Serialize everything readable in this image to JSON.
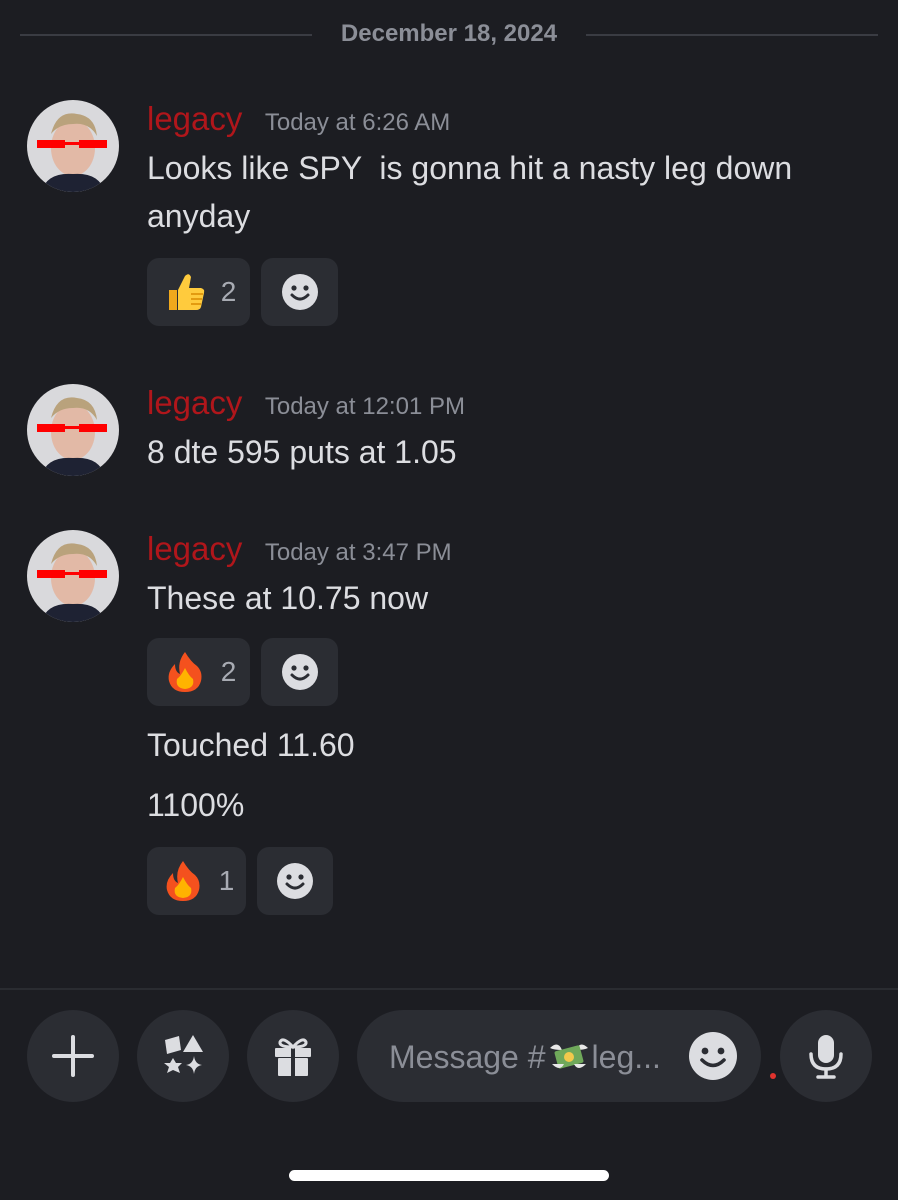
{
  "date_divider": "December 18, 2024",
  "messages": [
    {
      "author": "legacy",
      "timestamp": "Today at 6:26 AM",
      "lines": [
        "Looks like SPY  is gonna hit a nasty leg down",
        "anyday"
      ],
      "reactions": [
        {
          "emoji": "thumbs-up-icon",
          "count": "2"
        }
      ]
    },
    {
      "author": "legacy",
      "timestamp": "Today at 12:01 PM",
      "lines": [
        "8 dte 595 puts at 1.05"
      ]
    },
    {
      "author": "legacy",
      "timestamp": "Today at 3:47 PM",
      "lines": [
        "These at 10.75 now"
      ],
      "reactions": [
        {
          "emoji": "fire-icon",
          "count": "2"
        }
      ],
      "followups": [
        "Touched 11.60",
        "1100%"
      ],
      "followup_reactions": [
        {
          "emoji": "fire-icon",
          "count": "1"
        }
      ]
    }
  ],
  "composer": {
    "placeholder_prefix": "Message #",
    "placeholder_suffix": "leg..."
  },
  "colors": {
    "background": "#1c1d22",
    "author": "#b0161b",
    "reaction_bg": "#2b2d33",
    "muted": "#8b8e97"
  }
}
